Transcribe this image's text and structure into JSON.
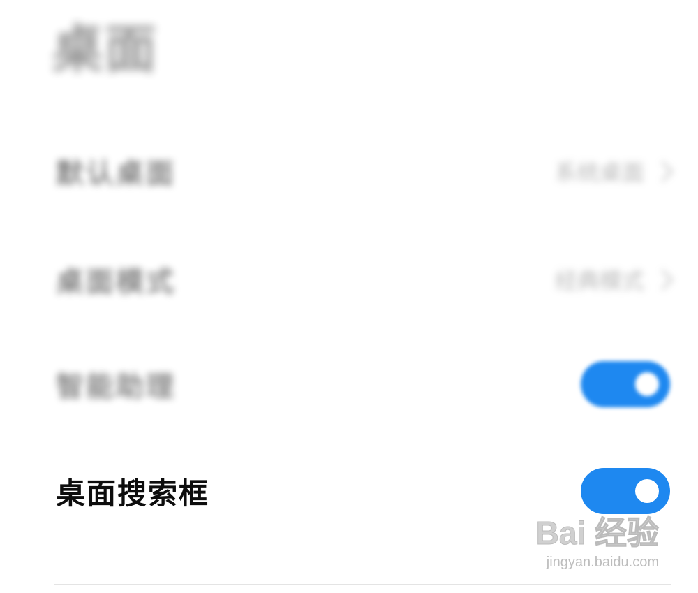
{
  "section": {
    "title": "桌面"
  },
  "settings": {
    "default_desktop": {
      "label": "默认桌面",
      "value": "系统桌面"
    },
    "desktop_mode": {
      "label": "桌面模式",
      "value": "经典模式"
    },
    "smart_assistant": {
      "label": "智能助理",
      "enabled": true
    },
    "desktop_search_box": {
      "label": "桌面搜索框",
      "enabled": true
    }
  },
  "colors": {
    "toggle_on": "#1e88f0",
    "knob": "#ffffff"
  },
  "watermark": {
    "brand": "Bai 经验",
    "url": "jingyan.baidu.com"
  }
}
